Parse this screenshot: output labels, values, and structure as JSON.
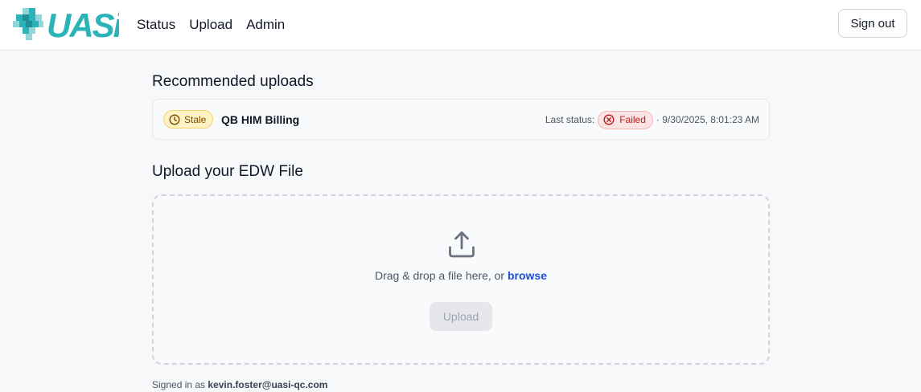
{
  "app": {
    "logo_text": "UASi",
    "colors": {
      "logo_teal": "#2bb3b8",
      "logo_light": "#8fd6da"
    }
  },
  "nav": {
    "items": [
      {
        "label": "Status"
      },
      {
        "label": "Upload"
      },
      {
        "label": "Admin"
      }
    ],
    "sign_out_label": "Sign out"
  },
  "recommended": {
    "title": "Recommended uploads",
    "items": [
      {
        "badge": "Stale",
        "badge_icon": "clock-icon",
        "name": "QB HIM Billing",
        "last_status_label": "Last status:",
        "status": "Failed",
        "status_icon": "x-circle-icon",
        "timestamp": "· 9/30/2025, 8:01:23 AM"
      }
    ]
  },
  "upload": {
    "title": "Upload your EDW File",
    "drop_text": "Drag & drop a file here, or",
    "browse_label": "browse",
    "button_label": "Upload",
    "icon": "upload-tray-icon"
  },
  "footer": {
    "signed_in_prefix": "Signed in as",
    "email": "kevin.foster@uasi-qc.com"
  }
}
